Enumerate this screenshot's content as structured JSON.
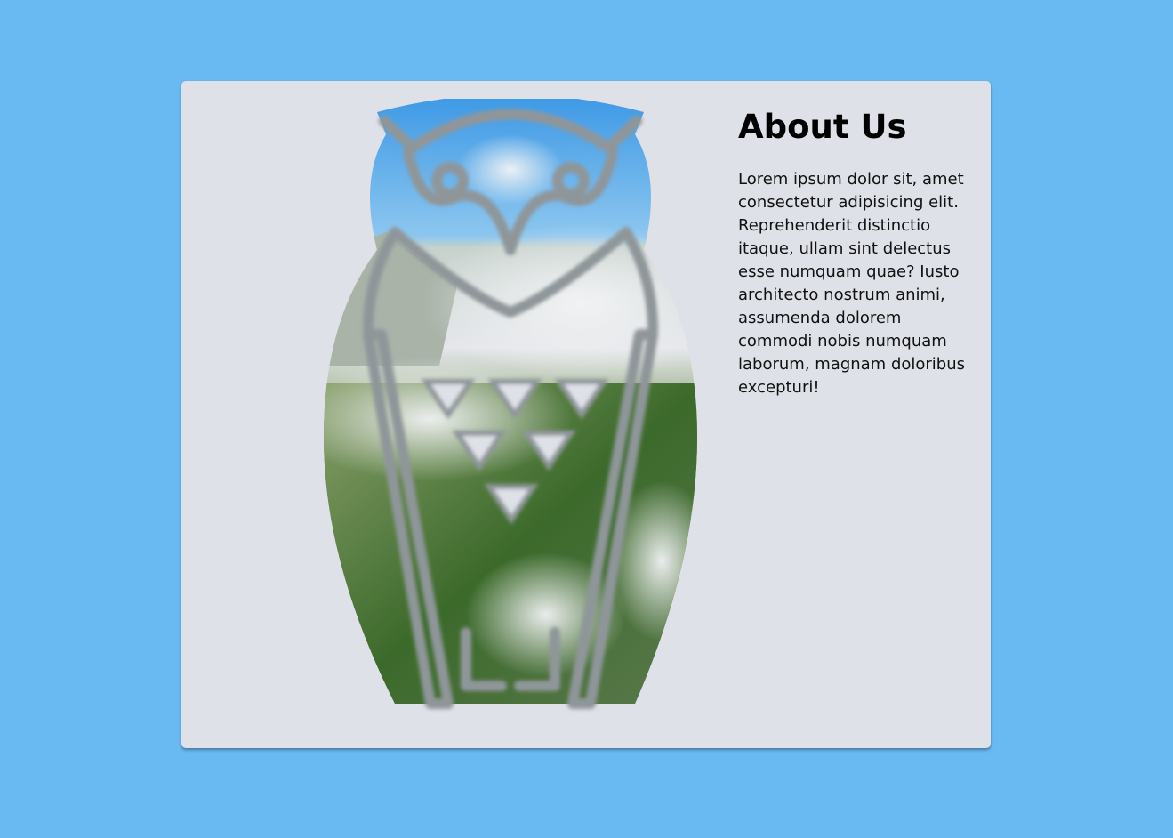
{
  "page": {
    "background_color": "#69b9f2",
    "card_color": "#dfe1e8"
  },
  "about": {
    "title": "About Us",
    "body": "Lorem ipsum dolor sit, amet consectetur adipisicing elit. Reprehenderit distinctio itaque, ullam sint delectus esse numquam quae? Iusto architecto nostrum animi, assumenda dolorem commodi nobis numquam laborum, magnam doloribus excepturi!"
  },
  "illustration": {
    "icon": "owl-icon",
    "fill_scene": "mountain forest with fog and sky"
  }
}
